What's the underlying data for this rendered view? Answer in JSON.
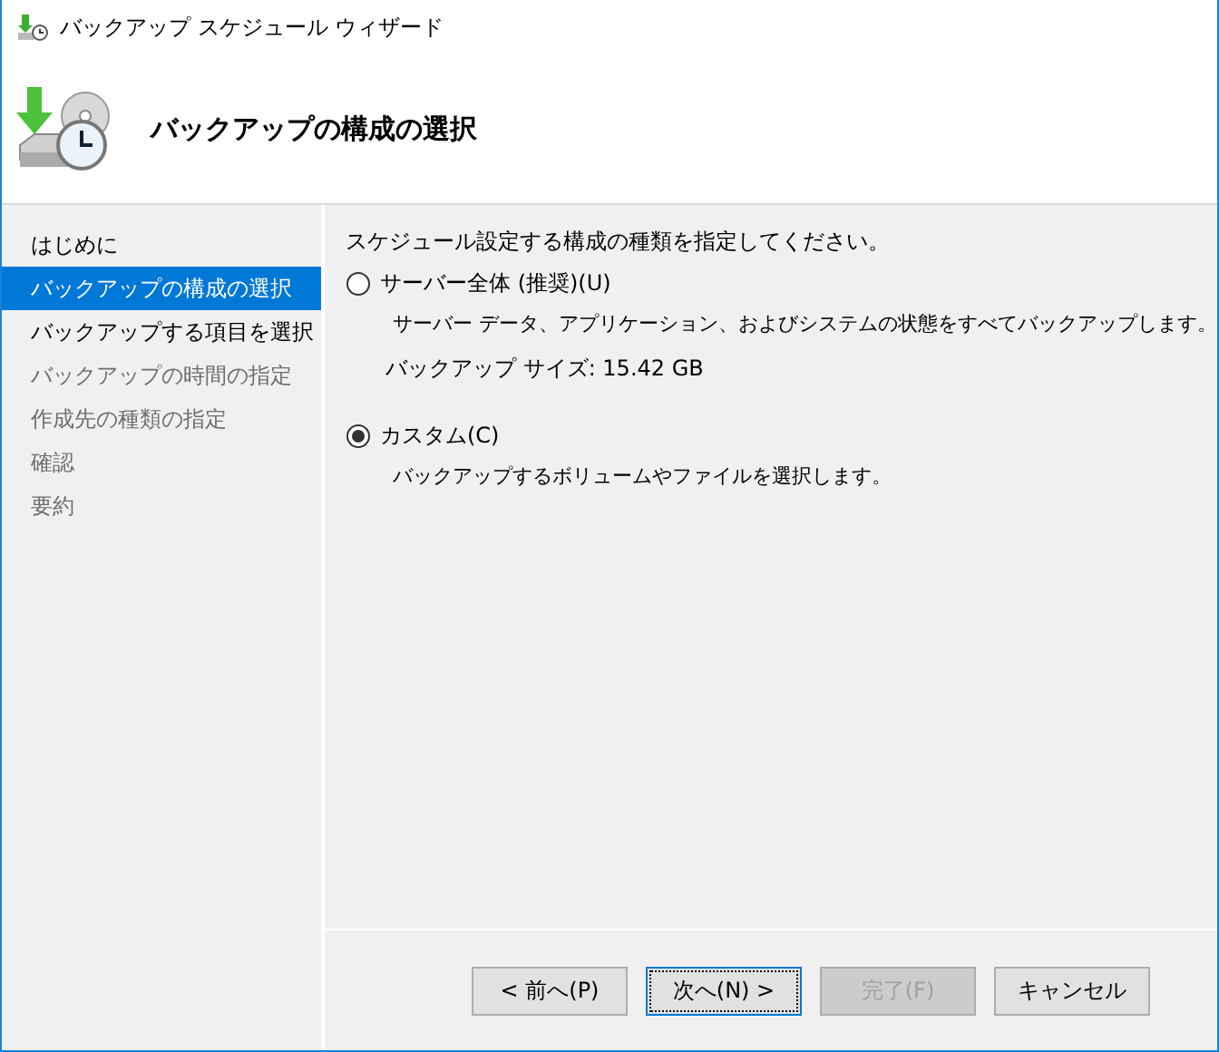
{
  "window": {
    "title": "バックアップ スケジュール ウィザード"
  },
  "header": {
    "title": "バックアップの構成の選択"
  },
  "sidebar": {
    "items": [
      {
        "label": "はじめに",
        "selected": false,
        "disabled": false
      },
      {
        "label": "バックアップの構成の選択",
        "selected": true,
        "disabled": false
      },
      {
        "label": "バックアップする項目を選択",
        "selected": false,
        "disabled": false
      },
      {
        "label": "バックアップの時間の指定",
        "selected": false,
        "disabled": true
      },
      {
        "label": "作成先の種類の指定",
        "selected": false,
        "disabled": true
      },
      {
        "label": "確認",
        "selected": false,
        "disabled": true
      },
      {
        "label": "要約",
        "selected": false,
        "disabled": true
      }
    ]
  },
  "content": {
    "prompt": "スケジュール設定する構成の種類を指定してください。",
    "options": [
      {
        "label": "サーバー全体 (推奨)(U)",
        "selected": false,
        "description": "サーバー データ、アプリケーション、およびシステムの状態をすべてバックアップします。",
        "size": "バックアップ サイズ: 15.42 GB"
      },
      {
        "label": "カスタム(C)",
        "selected": true,
        "description": "バックアップするボリュームやファイルを選択します。"
      }
    ]
  },
  "buttons": [
    {
      "label": "< 前へ(P)",
      "disabled": false,
      "focused": false
    },
    {
      "label": "次へ(N) >",
      "disabled": false,
      "focused": true
    },
    {
      "label": "完了(F)",
      "disabled": true,
      "focused": false
    },
    {
      "label": "キャンセル",
      "disabled": false,
      "focused": false
    }
  ]
}
